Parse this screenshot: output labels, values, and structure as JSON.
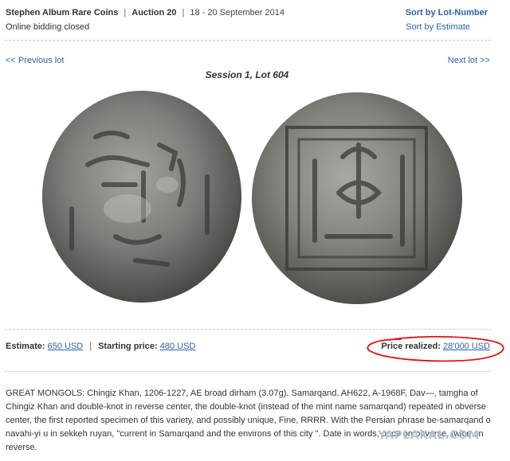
{
  "header": {
    "organization": "Stephen Album Rare Coins",
    "separator": "|",
    "auction": "Auction 20",
    "dates": "18 - 20 September 2014",
    "status": "Online bidding closed"
  },
  "sort": {
    "by_lot_number": "Sort by Lot-Number",
    "by_estimate": "Sort by Estimate"
  },
  "navigation": {
    "previous": "<< Previous lot",
    "next": "Next lot >>"
  },
  "lot": {
    "title": "Session 1, Lot 604"
  },
  "pricing": {
    "estimate_label": "Estimate:",
    "estimate_value": "650 USD",
    "separator": "|",
    "starting_label": "Starting price:",
    "starting_value": "480 USD",
    "realized_label": "Price realized:",
    "realized_value": "28'000 USD"
  },
  "description": "GREAT MONGOLS: Chingiz Khan, 1206-1227, AE broad dirham (3.07g), Samarqand, AH622, A-1968F, Dav—, tamgha of Chingiz Khan and double-knot in reverse center, the double-knot (instead of the mint name samarqand) repeated in obverse center, the first reported specimen of this variety, and possibly unique, Fine, RRRR. With the Persian phrase be-samarqand o navahi-yi u in sekkeh ruyan, \"current in Samarqand and the environs of this city \". Date in words, once on obverse, twice on reverse.",
  "watermark": "YAPLAKAL.COM",
  "colors": {
    "link": "#2f63a8",
    "annotation": "#e01010",
    "coin": "#7a7a76"
  }
}
